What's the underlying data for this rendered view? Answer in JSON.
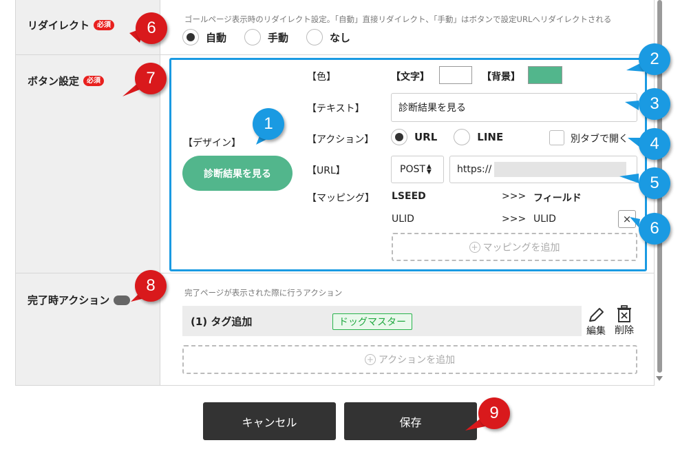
{
  "colors": {
    "accent_blue": "#1a9ae2",
    "marker_red": "#d9191c",
    "button_green": "#52b68c",
    "required_red": "#e8201e",
    "tag_green": "#27b34b",
    "dark_button": "#333333"
  },
  "redirect": {
    "label": "リダイレクト",
    "badge": "必須",
    "hint": "ゴールページ表示時のリダイレクト設定。「自動」直接リダイレクト、「手動」はボタンで設定URLへリダイレクトされる",
    "options": [
      {
        "label": "自動",
        "selected": true
      },
      {
        "label": "手動",
        "selected": false
      },
      {
        "label": "なし",
        "selected": false
      }
    ]
  },
  "button_settings": {
    "label": "ボタン設定",
    "badge": "必須",
    "design_label": "【デザイン】",
    "preview_button": "診断結果を見る",
    "color_label": "【色】",
    "text_color_label": "【文字】",
    "text_color": "#ffffff",
    "bg_color_label": "【背景】",
    "bg_color": "#52b68c",
    "text_label": "【テキスト】",
    "text_value": "診断結果を見る",
    "action_label": "【アクション】",
    "action_options": [
      {
        "label": "URL",
        "selected": true
      },
      {
        "label": "LINE",
        "selected": false
      }
    ],
    "new_tab_label": "別タブで開く",
    "url_label": "【URL】",
    "method": "POST",
    "url_value": "https://",
    "mapping_label": "【マッピング】",
    "mapping_header_left": "LSEED",
    "mapping_arrow": ">>>",
    "mapping_header_right": "フィールド",
    "mapping_rows": [
      {
        "left": "ULID",
        "arrow": ">>>",
        "right": "ULID"
      }
    ],
    "remove_mapping": "×",
    "add_mapping": "マッピングを追加"
  },
  "completion_action": {
    "label": "完了時アクション",
    "hint": "完了ページが表示された際に行うアクション",
    "actions": [
      {
        "title": "(1) タグ追加",
        "tag": "ドッグマスター"
      }
    ],
    "edit_label": "編集",
    "delete_label": "削除",
    "add_action": "アクションを追加"
  },
  "footer": {
    "cancel": "キャンセル",
    "save": "保存"
  },
  "markers": {
    "m6a": "6",
    "m7": "7",
    "m8": "8",
    "m9": "9",
    "b1": "1",
    "b2": "2",
    "b3": "3",
    "b4": "4",
    "b5": "5",
    "b6": "6"
  }
}
